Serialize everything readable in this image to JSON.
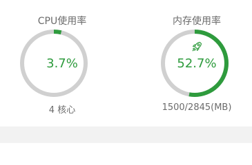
{
  "cpu": {
    "title": "CPU使用率",
    "percent_label": "3.7%",
    "percent_value": 0.037,
    "cores_label": "4 核心"
  },
  "memory": {
    "title": "内存使用率",
    "percent_label": "52.7%",
    "percent_value": 0.527,
    "usage_label": "1500/2845(MB)",
    "icon": "rocket-icon"
  },
  "colors": {
    "accent": "#2e9b3d",
    "track": "#d0d0d0",
    "text": "#6b6b6b",
    "footer": "#f2f2f2"
  }
}
